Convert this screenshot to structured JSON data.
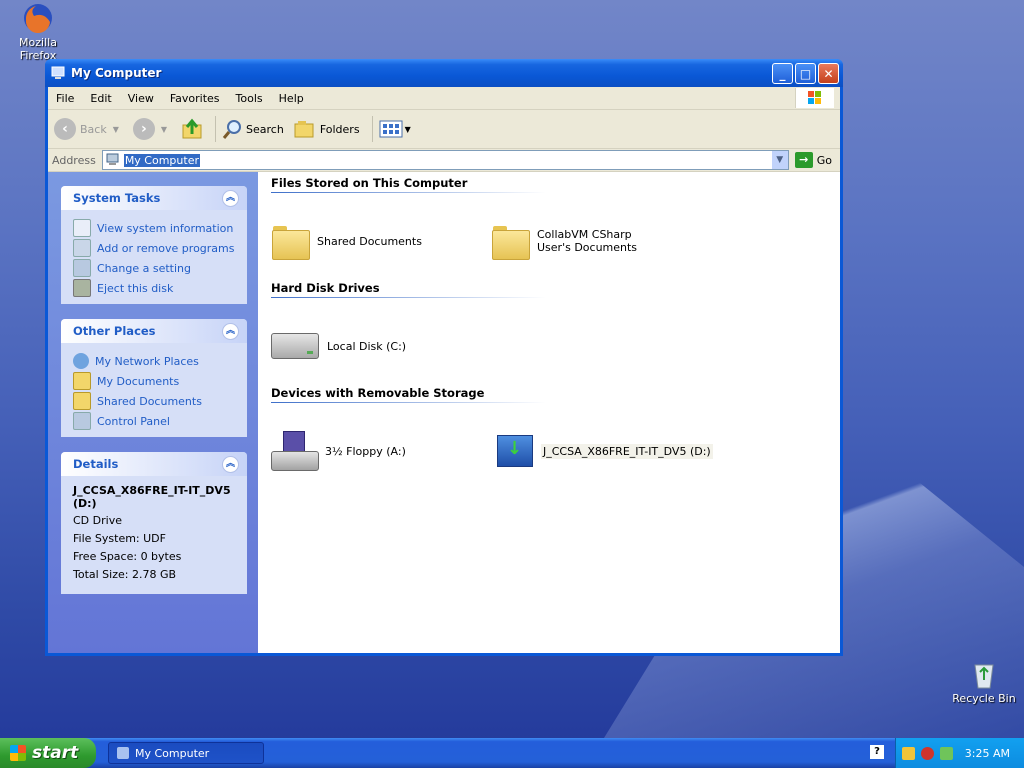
{
  "desktop": {
    "icons": [
      {
        "label": "Mozilla Firefox"
      },
      {
        "label": "Recycle Bin"
      }
    ]
  },
  "window": {
    "title": "My Computer",
    "controls": {
      "minimize": "_",
      "maximize": "□",
      "close": "✕"
    },
    "menu": [
      "File",
      "Edit",
      "View",
      "Favorites",
      "Tools",
      "Help"
    ],
    "toolbar": {
      "back": "Back",
      "search": "Search",
      "folders": "Folders"
    },
    "address": {
      "label": "Address",
      "value": "My Computer",
      "go": "Go"
    }
  },
  "left_pane": {
    "system_tasks": {
      "title": "System Tasks",
      "links": [
        "View system information",
        "Add or remove programs",
        "Change a setting",
        "Eject this disk"
      ]
    },
    "other_places": {
      "title": "Other Places",
      "links": [
        "My Network Places",
        "My Documents",
        "Shared Documents",
        "Control Panel"
      ]
    },
    "details": {
      "title": "Details",
      "name": "J_CCSA_X86FRE_IT-IT_DV5 (D:)",
      "type": "CD Drive",
      "file_system": "File System: UDF",
      "free_space": "Free Space: 0 bytes",
      "total_size": "Total Size: 2.78 GB"
    }
  },
  "right_pane": {
    "groups": [
      {
        "title": "Files Stored on This Computer",
        "items": [
          "Shared Documents",
          "CollabVM CSharp User's Documents"
        ]
      },
      {
        "title": "Hard Disk Drives",
        "items": [
          "Local Disk (C:)"
        ]
      },
      {
        "title": "Devices with Removable Storage",
        "items": [
          "3½ Floppy (A:)",
          "J_CCSA_X86FRE_IT-IT_DV5 (D:)"
        ]
      }
    ]
  },
  "taskbar": {
    "start_label": "start",
    "task_button": "My Computer",
    "clock": "3:25 AM"
  },
  "colors": {
    "title_blue": "#0a58d6",
    "link_blue": "#215dc6",
    "taskbar_blue": "#245edb",
    "start_green": "#2e9a2e"
  }
}
